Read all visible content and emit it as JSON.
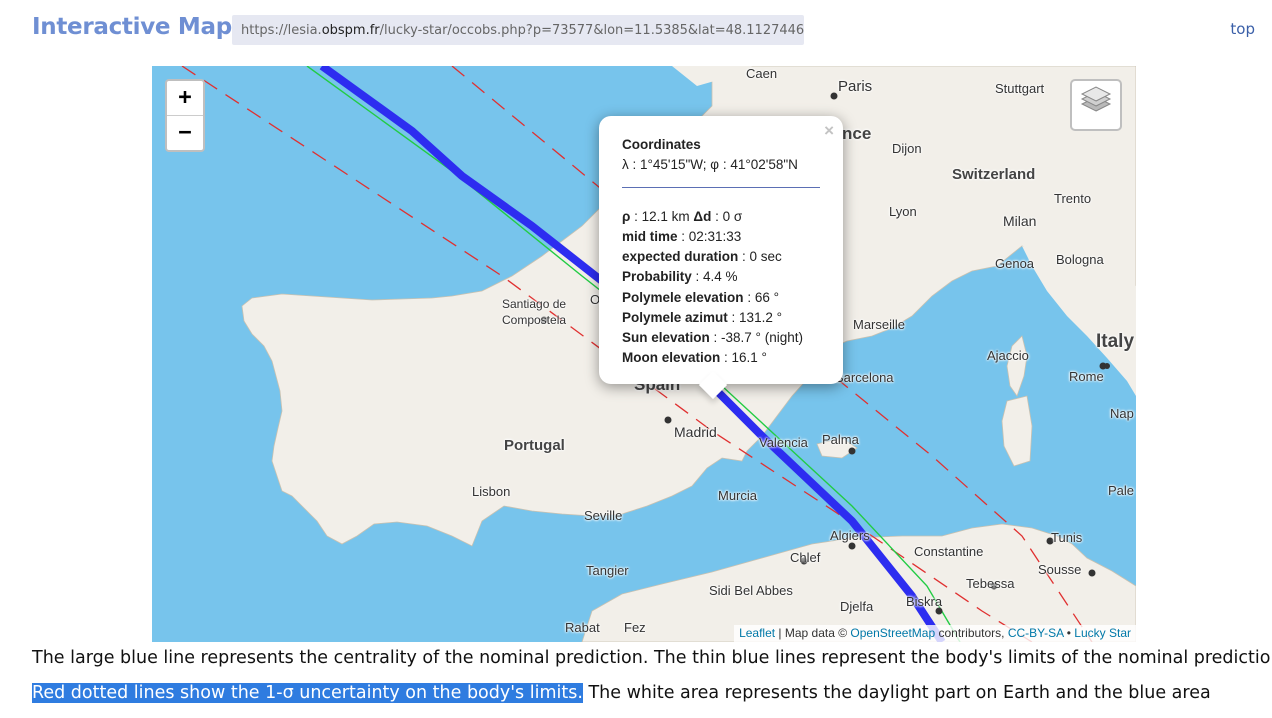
{
  "header": {
    "title": "Interactive Map",
    "url_prefix": "https://lesia.",
    "url_domain": "obspm.fr",
    "url_suffix": "/lucky-star/occobs.php?p=73577&lon=11.5385&lat=48.1127446",
    "top_link": "top"
  },
  "map": {
    "zoom_in": "+",
    "zoom_out": "−",
    "layers_icon": "layers-icon",
    "colors": {
      "sea": "#77c4ec",
      "land": "#f2efe9",
      "centrality": "#2d2df0",
      "limit": "#22cc44",
      "uncertainty": "#e03030"
    },
    "labels": {
      "caen": "Caen",
      "paris": "Paris",
      "stuttgart": "Stuttgart",
      "france": "nce",
      "dijon": "Dijon",
      "switzerland": "Switzerland",
      "trento": "Trento",
      "lyon": "Lyon",
      "milan": "Milan",
      "genoa": "Genoa",
      "bologna": "Bologna",
      "italy": "Italy",
      "marseille": "Marseille",
      "ajaccio": "Ajaccio",
      "rome": "Rome",
      "santiago1": "Santiago de",
      "santiago2": "Compostela",
      "spain": "Spain",
      "barcelona": "Barcelona",
      "portugal": "Portugal",
      "madrid": "Madrid",
      "valencia": "Valencia",
      "palma": "Palma",
      "lisbon": "Lisbon",
      "murcia": "Murcia",
      "seville": "Seville",
      "algiers": "Algiers",
      "tunis": "Tunis",
      "constantine": "Constantine",
      "chlef": "Chlef",
      "tangier": "Tangier",
      "sousse": "Sousse",
      "tebessa": "Tebessa",
      "sidi": "Sidi Bel Abbes",
      "djelfa": "Djelfa",
      "biskra": "Biskra",
      "rabat": "Rabat",
      "fez": "Fez",
      "nap": "Nap",
      "pale": "Pale",
      "o": "O"
    },
    "popup": {
      "close": "×",
      "coords_title": "Coordinates",
      "coords_value": "λ : 1°45'15\"W; φ : 41°02'58\"N",
      "rho_label": "ρ",
      "rho_value": " : 12.1 km ",
      "dd_label": "Δd",
      "dd_value": " : 0 σ",
      "rows": [
        {
          "label": "mid time",
          "value": " : 02:31:33"
        },
        {
          "label": "expected duration",
          "value": " : 0 sec"
        },
        {
          "label": "Probability",
          "value": " : 4.4 %"
        },
        {
          "label": "Polymele elevation",
          "value": " : 66 °"
        },
        {
          "label": "Polymele azimut",
          "value": " : 131.2 °"
        },
        {
          "label": "Sun elevation",
          "value": " : -38.7 ° (night)"
        },
        {
          "label": "Moon elevation",
          "value": " : 16.1 °"
        }
      ]
    },
    "attribution": {
      "leaflet": "Leaflet",
      "sep1": " | Map data © ",
      "osm": "OpenStreetMap",
      "contrib": " contributors, ",
      "license": "CC-BY-SA",
      "sep2": " • ",
      "lucky": "Lucky Star"
    }
  },
  "text": {
    "line1": "The large blue line represents the centrality of the nominal prediction. The thin blue lines represent the body's limits of the nominal prediction.",
    "line2_highlight": "Red dotted lines show the 1-σ uncertainty on the body's limits.",
    "line2_rest": " The white area represents the daylight part on Earth and the blue area"
  }
}
